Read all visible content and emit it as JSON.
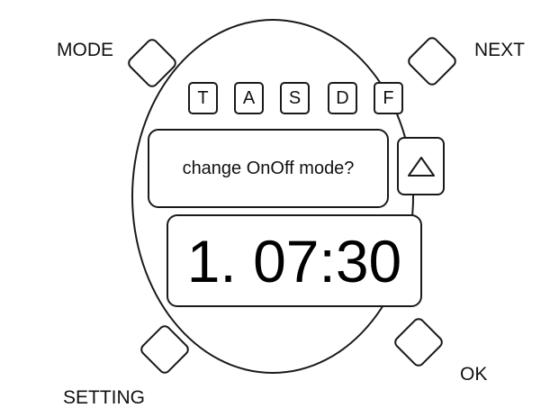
{
  "labels": {
    "mode": "MODE",
    "next": "NEXT",
    "setting": "SETTING",
    "ok": "OK"
  },
  "keys": [
    "T",
    "A",
    "S",
    "D",
    "F"
  ],
  "message": "change OnOff mode?",
  "time_display": "1. 07:30",
  "icons": {
    "up_button": "triangle-up-icon"
  },
  "colors": {
    "line": "#1a1a1a",
    "background": "#ffffff",
    "text": "#111111"
  }
}
